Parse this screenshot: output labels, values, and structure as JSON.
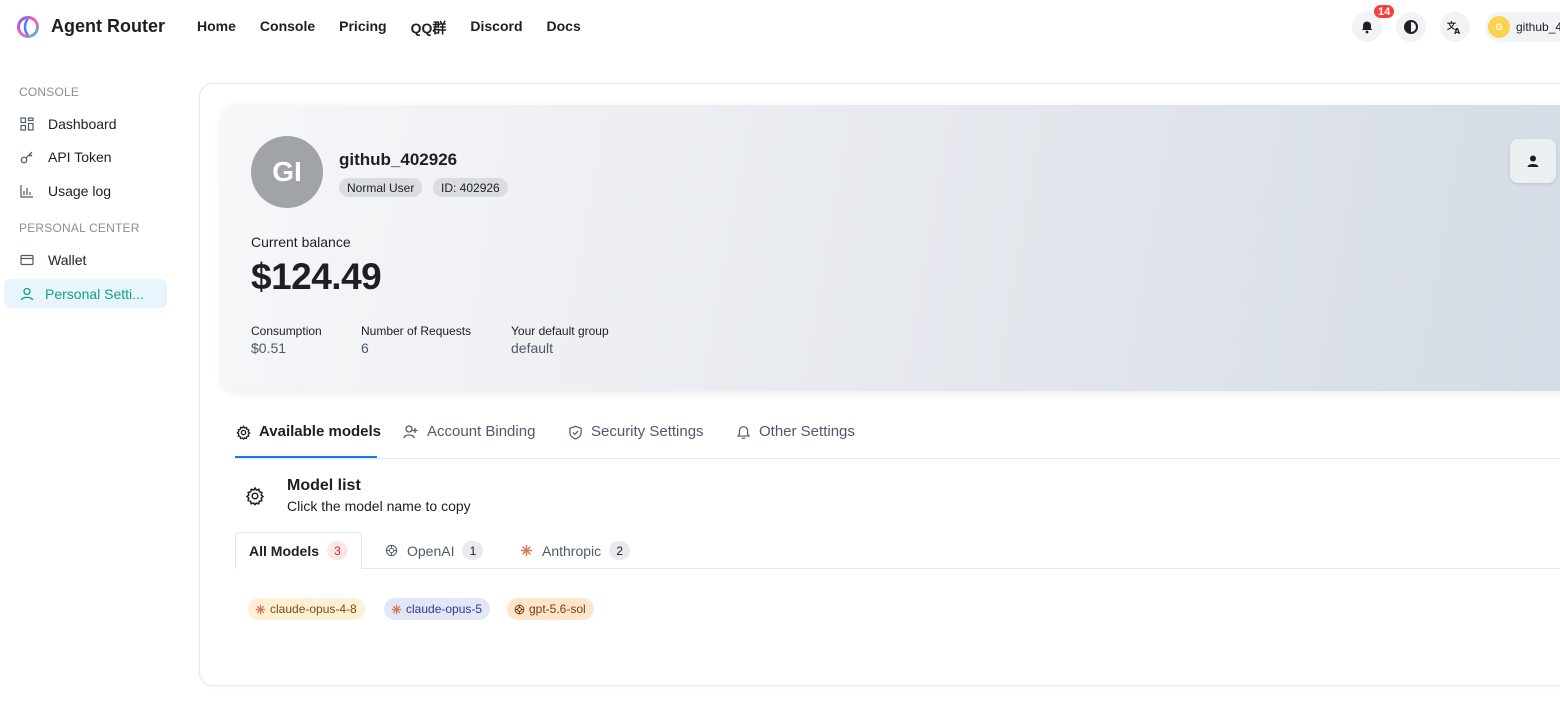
{
  "app": {
    "title": "Agent Router"
  },
  "nav": {
    "items": [
      "Home",
      "Console",
      "Pricing",
      "QQ群",
      "Discord",
      "Docs"
    ]
  },
  "header": {
    "notification_count": "14",
    "user_name": "github_4",
    "user_avatar_letter": "G"
  },
  "sidebar": {
    "sections": [
      {
        "title": "CONSOLE",
        "items": [
          {
            "label": "Dashboard",
            "icon": "dashboard-icon"
          },
          {
            "label": "API Token",
            "icon": "key-icon"
          },
          {
            "label": "Usage log",
            "icon": "chart-icon"
          }
        ]
      },
      {
        "title": "PERSONAL CENTER",
        "items": [
          {
            "label": "Wallet",
            "icon": "wallet-icon"
          },
          {
            "label": "Personal Setti...",
            "icon": "user-icon",
            "active": true
          }
        ]
      }
    ]
  },
  "profile": {
    "avatar_text": "GI",
    "username": "github_402926",
    "role_tag": "Normal User",
    "id_tag": "ID: 402926",
    "balance_label": "Current balance",
    "balance_value": "$124.49",
    "stats": [
      {
        "label": "Consumption",
        "value": "$0.51"
      },
      {
        "label": "Number of Requests",
        "value": "6"
      },
      {
        "label": "Your default group",
        "value": "default"
      }
    ]
  },
  "tabs": [
    {
      "label": "Available models",
      "icon": "gear-icon",
      "active": true
    },
    {
      "label": "Account Binding",
      "icon": "user-add-icon"
    },
    {
      "label": "Security Settings",
      "icon": "shield-icon"
    },
    {
      "label": "Other Settings",
      "icon": "bell-icon"
    }
  ],
  "model_list": {
    "title": "Model list",
    "subtitle": "Click the model name to copy",
    "filters": [
      {
        "label": "All Models",
        "count": "3",
        "active": true
      },
      {
        "label": "OpenAI",
        "count": "1",
        "icon": "openai-icon"
      },
      {
        "label": "Anthropic",
        "count": "2",
        "icon": "anthropic-icon"
      }
    ],
    "models": [
      {
        "name": "claude-opus-4-8",
        "icon": "anthropic-icon",
        "bg": "#fdf0d5",
        "fg": "#7a4a10"
      },
      {
        "name": "claude-opus-5",
        "icon": "anthropic-icon",
        "bg": "#e3e6f7",
        "fg": "#2d3a8c"
      },
      {
        "name": "gpt-5.6-sol",
        "icon": "openai-icon",
        "bg": "#fde6cc",
        "fg": "#7a3d0a"
      }
    ]
  },
  "colors": {
    "accent": "#1677ff",
    "active_green": "#14a085",
    "badge_red": "#f53f3f",
    "anthropic_orange": "#d97757"
  }
}
